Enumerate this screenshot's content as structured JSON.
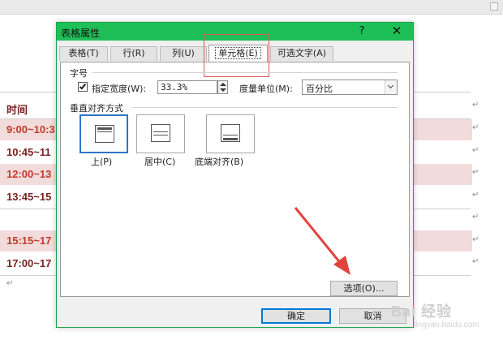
{
  "document": {
    "header_cell": "时间",
    "rows": [
      {
        "time": "9:00~10:3",
        "shaded": true
      },
      {
        "time": "10:45~11",
        "shaded": false
      },
      {
        "time": "12:00~13",
        "shaded": true
      },
      {
        "time": "13:45~15",
        "shaded": false
      },
      {
        "time": "15:15~17",
        "shaded": true
      },
      {
        "time": "17:00~17",
        "shaded": false
      }
    ],
    "cell_mark": "↵",
    "end_mark": "↵"
  },
  "dialog": {
    "title": "表格属性",
    "help_label": "?",
    "close_label": "✕",
    "tabs": [
      {
        "label": "表格(T)",
        "active": false
      },
      {
        "label": "行(R)",
        "active": false
      },
      {
        "label": "列(U)",
        "active": false
      },
      {
        "label": "单元格(E)",
        "active": true
      },
      {
        "label": "可选文字(A)",
        "active": false
      }
    ],
    "size_section": "字号",
    "preferred_width_label": "指定宽度(W):",
    "preferred_width_checked": true,
    "width_value": "33.3%",
    "measure_label": "度量单位(M):",
    "measure_value": "百分比",
    "valign_section": "垂直对齐方式",
    "valign_options": [
      {
        "label": "上(P)",
        "selected": true
      },
      {
        "label": "居中(C)",
        "selected": false
      },
      {
        "label": "底端对齐(B)",
        "selected": false
      }
    ],
    "options_button": "选项(O)...",
    "ok_button": "确定",
    "cancel_button": "取消"
  },
  "watermark": {
    "text": "Bai 经验",
    "sub": "jingyan.baidu.com"
  },
  "colors": {
    "title_bar": "#1fbf58",
    "row_shade": "#f2dcdb",
    "cell_text": "#c0392b",
    "annotation": "#e0565b",
    "selected_border": "#2d75c8"
  }
}
